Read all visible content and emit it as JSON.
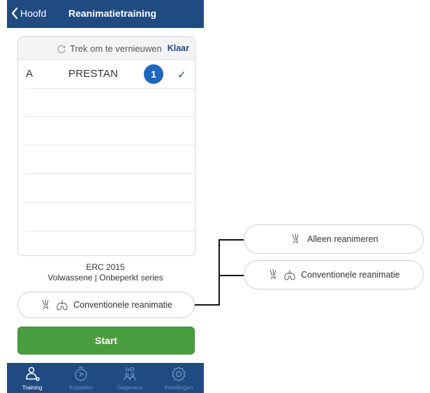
{
  "nav": {
    "back_label": "Hoofd",
    "title": "Reanimatietraining"
  },
  "list": {
    "refresh_label": "Trek om te vernieuwen",
    "done_label": "Klaar",
    "rows": [
      {
        "letter": "A",
        "device": "PRESTAN",
        "badge": "1",
        "check": "✓"
      }
    ]
  },
  "protocol": {
    "line1": "ERC 2015",
    "line2": "Volwassene | Onbeperkt series"
  },
  "mode_selector": {
    "selected": "Conventionele reanimatie"
  },
  "options": [
    {
      "label": "Alleen reanimeren",
      "icon": "hands-cpr-icon"
    },
    {
      "label": "Conventionele reanimatie",
      "icon": "hands-lungs-icon"
    }
  ],
  "start_label": "Start",
  "tabbar": {
    "tabs": [
      {
        "label": "Training",
        "icon": "training-icon",
        "active": true
      },
      {
        "label": "Koppelen",
        "icon": "connect-icon",
        "active": false
      },
      {
        "label": "Gegevens",
        "icon": "data-icon",
        "active": false
      },
      {
        "label": "Instellingen",
        "icon": "gear-icon",
        "active": false
      }
    ]
  },
  "colors": {
    "primary": "#1f4a82",
    "badge": "#1f67c1",
    "start": "#4a9d3f",
    "tab_inactive": "#6e8fbc"
  }
}
